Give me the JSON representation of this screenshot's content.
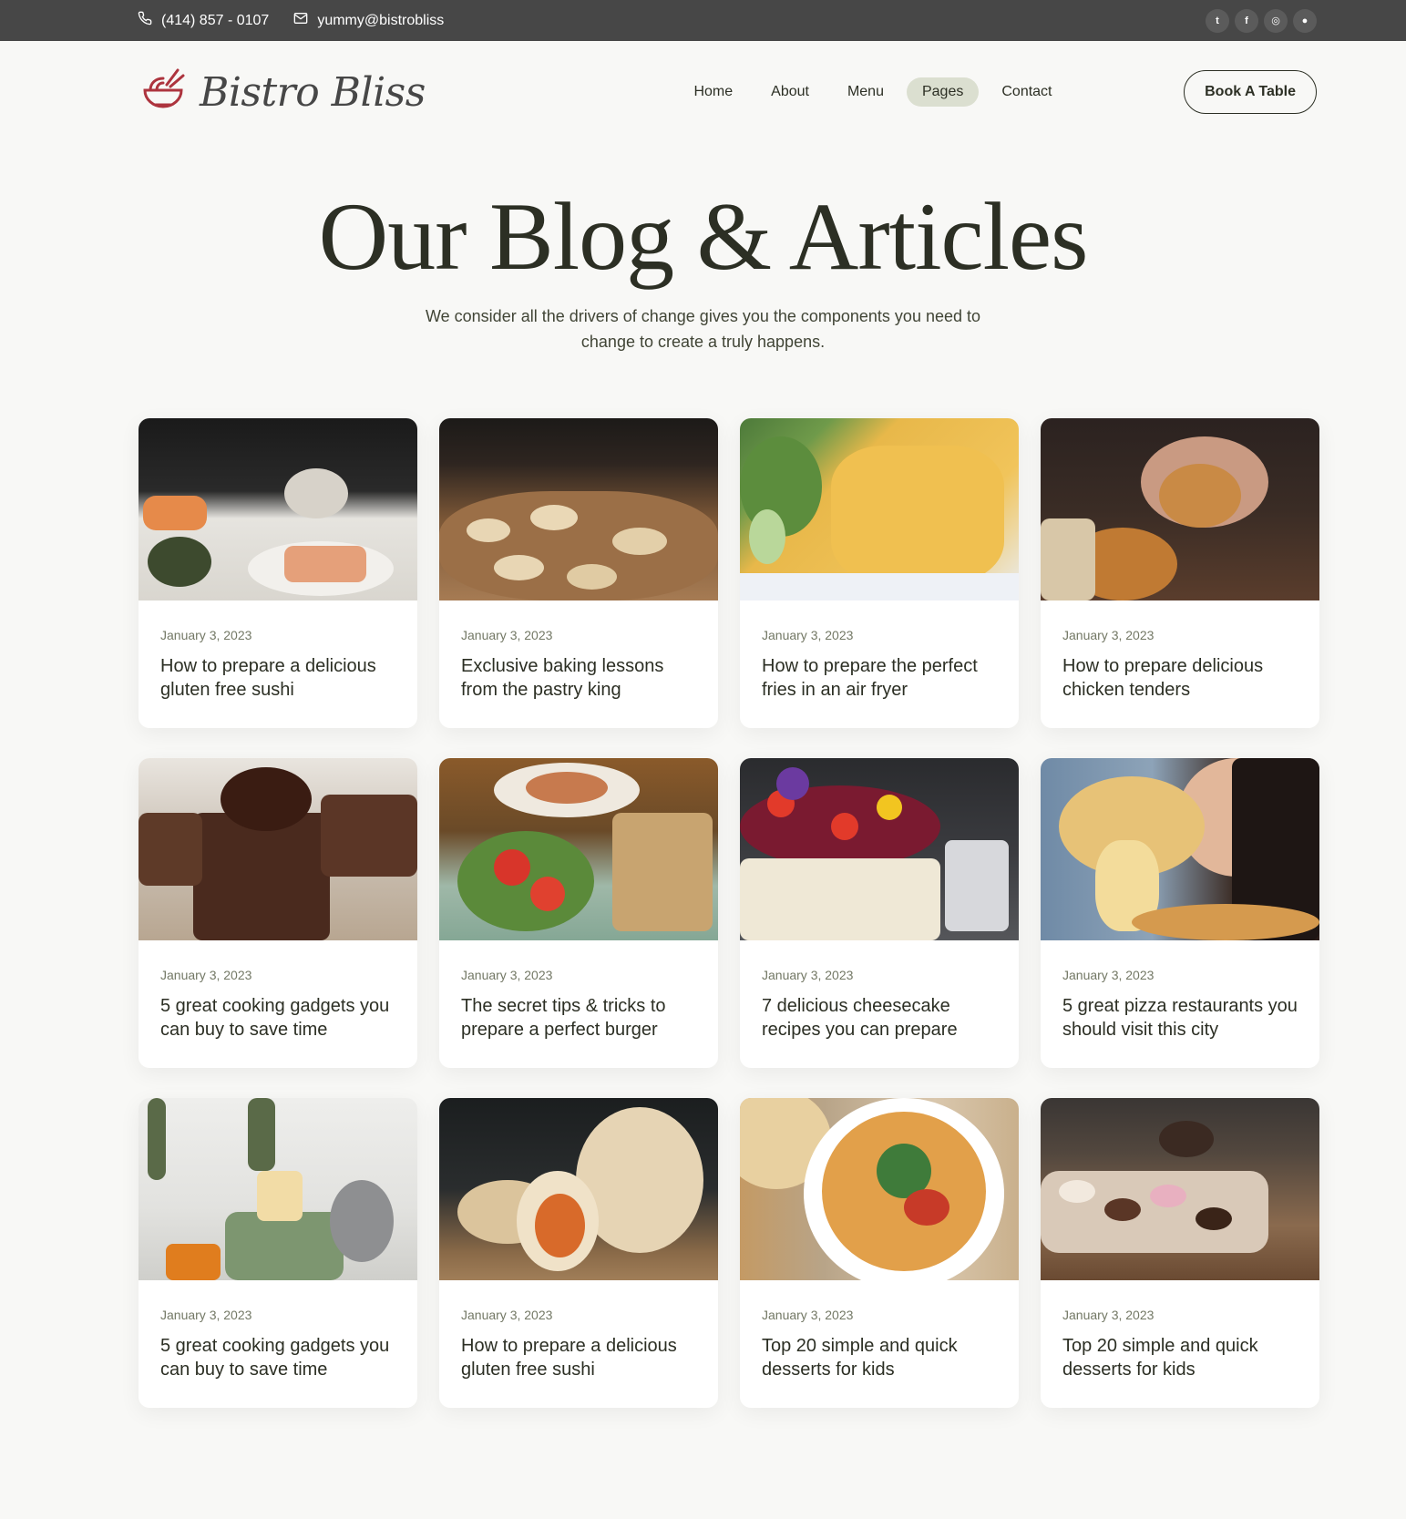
{
  "topbar": {
    "phone": "(414) 857 - 0107",
    "email": "yummy@bistrobliss",
    "social": [
      {
        "icon": "twitter-icon",
        "glyph": "t"
      },
      {
        "icon": "facebook-icon",
        "glyph": "f"
      },
      {
        "icon": "instagram-icon",
        "glyph": "◎"
      },
      {
        "icon": "github-icon",
        "glyph": "●"
      }
    ]
  },
  "header": {
    "brand": "Bistro Bliss",
    "nav": [
      "Home",
      "About",
      "Menu",
      "Pages",
      "Contact"
    ],
    "active_nav": "Pages",
    "cta": "Book A Table"
  },
  "hero": {
    "title": "Our Blog & Articles",
    "subtitle": "We consider all the drivers of change gives you the components you need to change to create a truly happens."
  },
  "posts": [
    {
      "date": "January 3, 2023",
      "title": "How to prepare a delicious gluten free sushi",
      "image": "sushi-photo"
    },
    {
      "date": "January 3, 2023",
      "title": "Exclusive baking lessons from the pastry king",
      "image": "pastry-photo"
    },
    {
      "date": "January 3, 2023",
      "title": "How to prepare the perfect fries in an air fryer",
      "image": "fries-photo"
    },
    {
      "date": "January 3, 2023",
      "title": "How to prepare delicious chicken tenders",
      "image": "chicken-photo"
    },
    {
      "date": "January 3, 2023",
      "title": "5 great cooking gadgets you can buy to save time",
      "image": "brownie-photo"
    },
    {
      "date": "January 3, 2023",
      "title": "The secret tips & tricks to prepare a perfect burger",
      "image": "salad-photo"
    },
    {
      "date": "January 3, 2023",
      "title": "7 delicious cheesecake recipes you can prepare",
      "image": "cheesecake-photo"
    },
    {
      "date": "January 3, 2023",
      "title": "5 great pizza restaurants you should visit this city",
      "image": "pizza-photo"
    },
    {
      "date": "January 3, 2023",
      "title": "5 great cooking gadgets you can buy to save time",
      "image": "toaster-photo"
    },
    {
      "date": "January 3, 2023",
      "title": "How to prepare a delicious gluten free sushi",
      "image": "burrito-photo"
    },
    {
      "date": "January 3, 2023",
      "title": "Top 20 simple and quick desserts for kids",
      "image": "noodles-photo"
    },
    {
      "date": "January 3, 2023",
      "title": "Top 20 simple and quick desserts for kids",
      "image": "desserts-photo"
    }
  ],
  "colors": {
    "topbar": "#474747",
    "accent_red": "#ad343e",
    "text_dark": "#2c2f24",
    "nav_active": "#dbdfd0",
    "page_bg": "#f8f8f6"
  }
}
